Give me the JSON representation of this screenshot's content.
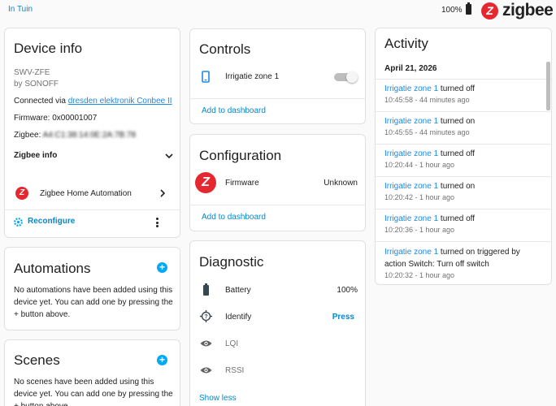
{
  "topbar": {
    "breadcrumb": "In Tuin",
    "battery": "100%",
    "brand": "zigbee",
    "brand_logo_letter": "Z"
  },
  "device_info": {
    "title": "Device info",
    "model": "SWV-ZFE",
    "manufacturer": "by SONOFF",
    "connected_prefix": "Connected via ",
    "connected_link": "dresden elektronik Conbee II",
    "firmware": "Firmware: 0x00001007",
    "zigbee_prefix": "Zigbee: ",
    "zigbee_value": "A4:C1:38:14:0E:2A:7B:78",
    "zigbee_info": "Zigbee info",
    "integration": "Zigbee Home Automation",
    "reconfigure": "Reconfigure"
  },
  "automations": {
    "title": "Automations",
    "text": "No automations have been added using this device yet. You can add one by pressing the + button above."
  },
  "scenes": {
    "title": "Scenes",
    "text": "No scenes have been added using this device yet. You can add one by pressing the + button above."
  },
  "controls": {
    "title": "Controls",
    "entity": "Irrigatie zone 1",
    "add_to_dashboard": "Add to dashboard",
    "toggle_state": "off"
  },
  "configuration": {
    "title": "Configuration",
    "firmware_label": "Firmware",
    "firmware_value": "Unknown",
    "add_to_dashboard": "Add to dashboard"
  },
  "diagnostic": {
    "title": "Diagnostic",
    "battery_label": "Battery",
    "battery_value": "100%",
    "identify_label": "Identify",
    "identify_action": "Press",
    "lqi_label": "LQI",
    "rssi_label": "RSSI",
    "show_less": "Show less"
  },
  "activity": {
    "title": "Activity",
    "date": "April 21, 2026",
    "entries": [
      {
        "entity": "Irrigatie zone 1",
        "action": " turned off",
        "time": "10:45:58 - 44 minutes ago"
      },
      {
        "entity": "Irrigatie zone 1",
        "action": " turned on",
        "time": "10:45:55 - 44 minutes ago"
      },
      {
        "entity": "Irrigatie zone 1",
        "action": " turned off",
        "time": "10:20:44 - 1 hour ago"
      },
      {
        "entity": "Irrigatie zone 1",
        "action": " turned on",
        "time": "10:20:42 - 1 hour ago"
      },
      {
        "entity": "Irrigatie zone 1",
        "action": " turned off",
        "time": "10:20:36 - 1 hour ago"
      },
      {
        "entity": "Irrigatie zone 1",
        "action": " turned on triggered by",
        "action2": "action Switch: Turn off switch",
        "time": "10:20:32 - 1 hour ago"
      }
    ]
  },
  "colors": {
    "accent": "#03a9f4",
    "zigbee_red": "#e52830",
    "link": "#1e88e5"
  }
}
